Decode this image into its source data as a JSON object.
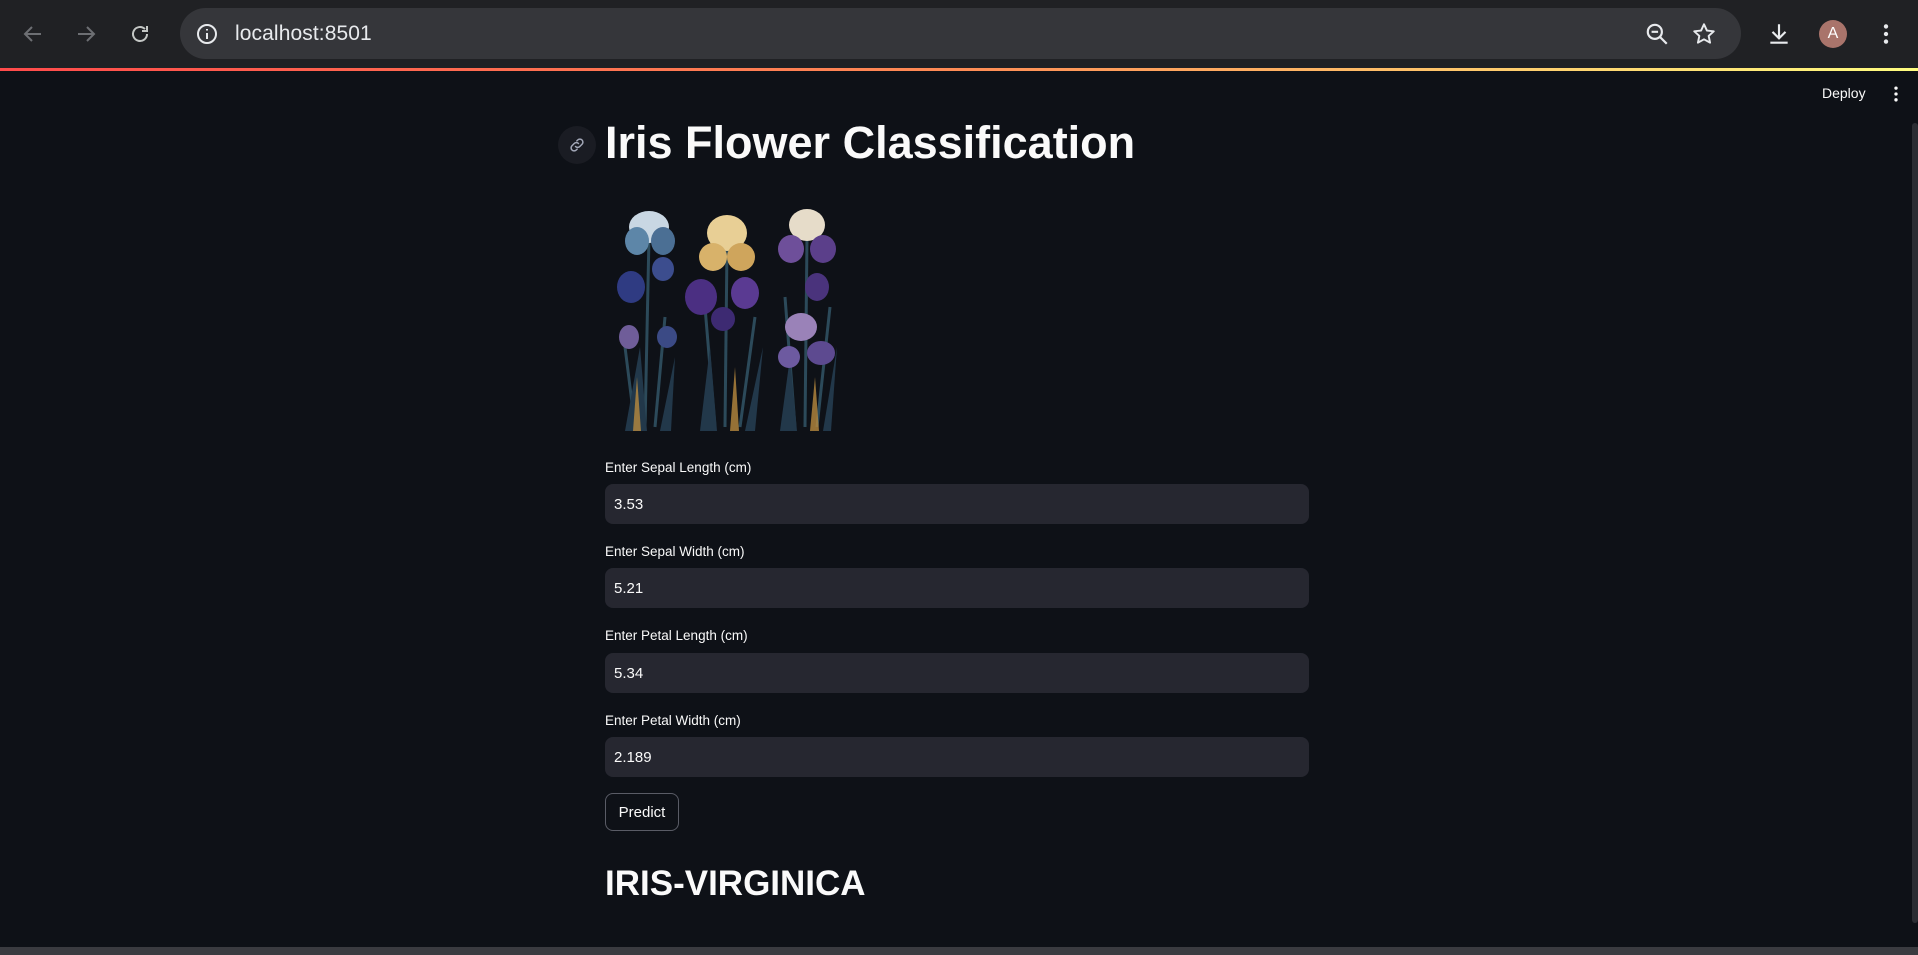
{
  "browser": {
    "url": "localhost:8501",
    "profile_initial": "A"
  },
  "app": {
    "deploy_label": "Deploy",
    "title": "Iris Flower Classification",
    "fields": [
      {
        "label": "Enter Sepal Length (cm)",
        "value": "3.53"
      },
      {
        "label": "Enter Sepal Width (cm)",
        "value": "5.21"
      },
      {
        "label": "Enter Petal Length (cm)",
        "value": "5.34"
      },
      {
        "label": "Enter Petal Width (cm)",
        "value": "2.189"
      }
    ],
    "predict_label": "Predict",
    "result": "IRIS-VIRGINICA"
  },
  "colors": {
    "chrome_bg": "#202124",
    "omnibox_bg": "#35363a",
    "app_bg": "#0e1117",
    "input_bg": "#262730",
    "accent": "#ff4b4b"
  },
  "icons": [
    "back-arrow-icon",
    "forward-arrow-icon",
    "reload-icon",
    "site-info-icon",
    "zoom-icon",
    "bookmark-star-icon",
    "download-icon",
    "kebab-menu-icon",
    "link-icon"
  ]
}
